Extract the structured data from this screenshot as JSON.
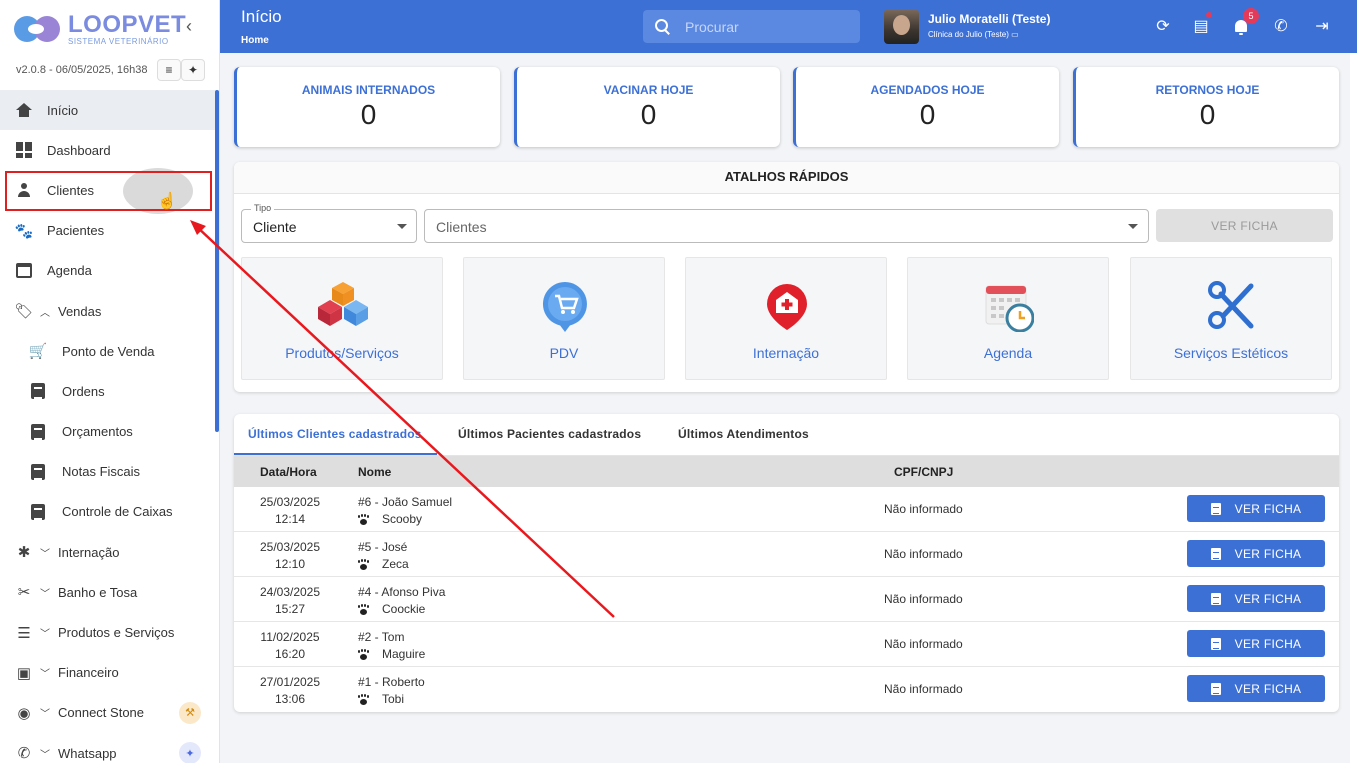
{
  "sidebar": {
    "logo_title": "LOOPVET",
    "logo_subtitle": "SISTEMA VETERINÁRIO",
    "version": "v2.0.8 - 06/05/2025, 16h38",
    "items": [
      {
        "label": "Início",
        "icon": "home-icon"
      },
      {
        "label": "Dashboard",
        "icon": "dashboard-icon"
      },
      {
        "label": "Clientes",
        "icon": "person-icon"
      },
      {
        "label": "Pacientes",
        "icon": "paw-icon"
      },
      {
        "label": "Agenda",
        "icon": "calendar-icon"
      },
      {
        "label": "Vendas",
        "icon": "tag-icon"
      },
      {
        "label": "Ponto de Venda",
        "icon": "cart-icon"
      },
      {
        "label": "Ordens",
        "icon": "list-icon"
      },
      {
        "label": "Orçamentos",
        "icon": "list-icon"
      },
      {
        "label": "Notas Fiscais",
        "icon": "document-icon"
      },
      {
        "label": "Controle de Caixas",
        "icon": "cashbox-icon"
      },
      {
        "label": "Internação",
        "icon": "asterisk-icon"
      },
      {
        "label": "Banho e Tosa",
        "icon": "scissors-icon"
      },
      {
        "label": "Produtos e Serviços",
        "icon": "storage-icon"
      },
      {
        "label": "Financeiro",
        "icon": "money-icon"
      },
      {
        "label": "Connect Stone",
        "icon": "contactless-icon"
      },
      {
        "label": "Whatsapp",
        "icon": "whatsapp-icon"
      }
    ]
  },
  "header": {
    "title": "Início",
    "breadcrumb": "Home",
    "search_placeholder": "Procurar",
    "user_name": "Julio Moratelli (Teste)",
    "clinic": "Clínica do Julio (Teste)",
    "notification_count": "5",
    "accent": "#3d70d5"
  },
  "stats": [
    {
      "title": "ANIMAIS INTERNADOS",
      "value": "0"
    },
    {
      "title": "VACINAR HOJE",
      "value": "0"
    },
    {
      "title": "AGENDADOS HOJE",
      "value": "0"
    },
    {
      "title": "RETORNOS HOJE",
      "value": "0"
    }
  ],
  "shortcuts": {
    "title": "ATALHOS RÁPIDOS",
    "tipo_label": "Tipo",
    "tipo_value": "Cliente",
    "clientes_placeholder": "Clientes",
    "ver_ficha": "VER FICHA",
    "tiles": [
      {
        "label": "Produtos/Serviços",
        "icon": "boxes-icon"
      },
      {
        "label": "PDV",
        "icon": "pdv-cart-icon"
      },
      {
        "label": "Internação",
        "icon": "hospital-pin-icon"
      },
      {
        "label": "Agenda",
        "icon": "calendar-clock-icon"
      },
      {
        "label": "Serviços Estéticos",
        "icon": "scissors-icon"
      }
    ]
  },
  "recent": {
    "tabs": [
      "Últimos Clientes cadastrados",
      "Últimos Pacientes cadastrados",
      "Últimos Atendimentos"
    ],
    "columns": [
      "Data/Hora",
      "Nome",
      "CPF/CNPJ"
    ],
    "button_label": "VER FICHA",
    "rows": [
      {
        "date": "25/03/2025",
        "time": "12:14",
        "name": "#6 - João Samuel",
        "pet": "Scooby",
        "cpf": "Não informado"
      },
      {
        "date": "25/03/2025",
        "time": "12:10",
        "name": "#5 - José",
        "pet": "Zeca",
        "cpf": "Não informado"
      },
      {
        "date": "24/03/2025",
        "time": "15:27",
        "name": "#4 - Afonso Piva",
        "pet": "Coockie",
        "cpf": "Não informado"
      },
      {
        "date": "11/02/2025",
        "time": "16:20",
        "name": "#2 - Tom",
        "pet": "Maguire",
        "cpf": "Não informado"
      },
      {
        "date": "27/01/2025",
        "time": "13:06",
        "name": "#1 - Roberto",
        "pet": "Tobi",
        "cpf": "Não informado"
      }
    ]
  }
}
